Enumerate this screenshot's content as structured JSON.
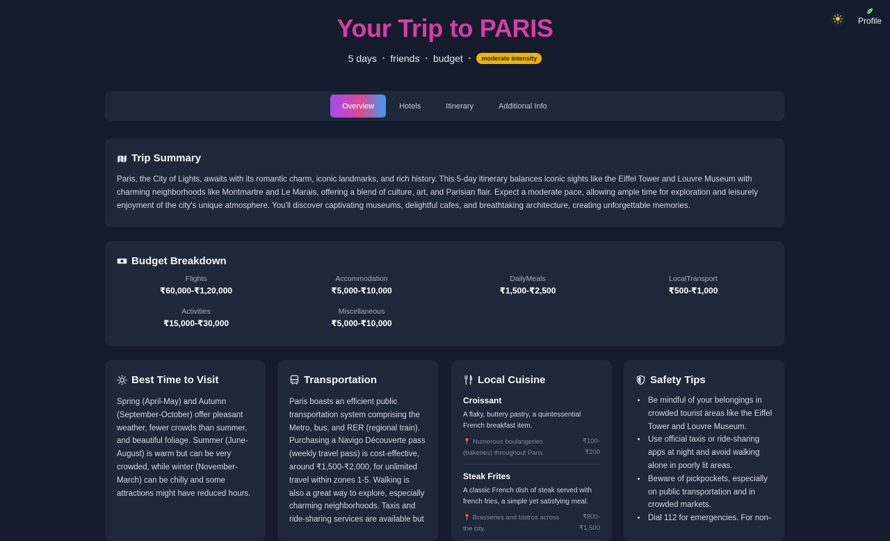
{
  "header": {
    "title": "Your Trip to PARIS",
    "meta": [
      "5 days",
      "friends",
      "budget"
    ],
    "intensity_badge": "moderate intensity",
    "profile_label": "Profile"
  },
  "tabs": [
    {
      "label": "Overview",
      "active": true
    },
    {
      "label": "Hotels",
      "active": false
    },
    {
      "label": "Itinerary",
      "active": false
    },
    {
      "label": "Additional Info",
      "active": false
    }
  ],
  "summary": {
    "title": "Trip Summary",
    "text": "Paris, the City of Lights, awaits with its romantic charm, iconic landmarks, and rich history. This 5-day itinerary balances iconic sights like the Eiffel Tower and Louvre Museum with charming neighborhoods like Montmartre and Le Marais, offering a blend of culture, art, and Parisian flair. Expect a moderate pace, allowing ample time for exploration and leisurely enjoyment of the city's unique atmosphere. You'll discover captivating museums, delightful cafes, and breathtaking architecture, creating unforgettable memories."
  },
  "budget": {
    "title": "Budget Breakdown",
    "items": [
      {
        "label": "Flights",
        "value": "₹60,000-₹1,20,000"
      },
      {
        "label": "Accommodation",
        "value": "₹5,000-₹10,000"
      },
      {
        "label": "DailyMeals",
        "value": "₹1,500-₹2,500"
      },
      {
        "label": "LocalTransport",
        "value": "₹500-₹1,000"
      },
      {
        "label": "Activities",
        "value": "₹15,000-₹30,000"
      },
      {
        "label": "Miscellaneous",
        "value": "₹5,000-₹10,000"
      }
    ]
  },
  "best_time": {
    "title": "Best Time to Visit",
    "text": "Spring (April-May) and Autumn (September-October) offer pleasant weather, fewer crowds than summer, and beautiful foliage. Summer (June-August) is warm but can be very crowded, while winter (November-March) can be chilly and some attractions might have reduced hours."
  },
  "transportation": {
    "title": "Transportation",
    "text": "Paris boasts an efficient public transportation system comprising the Metro, bus, and RER (regional train). Purchasing a Navigo Découverte pass (weekly travel pass) is cost-effective, around ₹1,500-₹2,000, for unlimited travel within zones 1-5. Walking is also a great way to explore, especially charming neighborhoods. Taxis and ride-sharing services are available but"
  },
  "cuisine": {
    "title": "Local Cuisine",
    "dishes": [
      {
        "name": "Croissant",
        "description": "A flaky, buttery pastry, a quintessential French breakfast item.",
        "where": "Numerous boulangeries (bakeries) throughout Paris.",
        "price": "₹100-₹200"
      },
      {
        "name": "Steak Frites",
        "description": "A classic French dish of steak served with french fries, a simple yet satisfying meal.",
        "where": "Brasseries and bistros across the city.",
        "price": "₹800-₹1,500"
      }
    ]
  },
  "safety": {
    "title": "Safety Tips",
    "tips": [
      "Be mindful of your belongings in crowded tourist areas like the Eiffel Tower and Louvre Museum.",
      "Use official taxis or ride-sharing apps at night and avoid walking alone in poorly lit areas.",
      "Beware of pickpockets, especially on public transportation and in crowded markets.",
      "Dial 112 for emergencies. For non-"
    ]
  },
  "colors": {
    "background": "#141b2d",
    "card": "#1f2838",
    "title_pink": "#d63ea2",
    "badge_yellow": "#f0b400"
  },
  "icons": {
    "theme": "sun-icon",
    "profile": "leaf-icon",
    "summary": "map-icon",
    "budget": "money-icon",
    "best_time": "sun-icon",
    "transportation": "bus-icon",
    "cuisine": "utensils-icon",
    "safety": "shield-icon",
    "location": "pin-icon"
  }
}
